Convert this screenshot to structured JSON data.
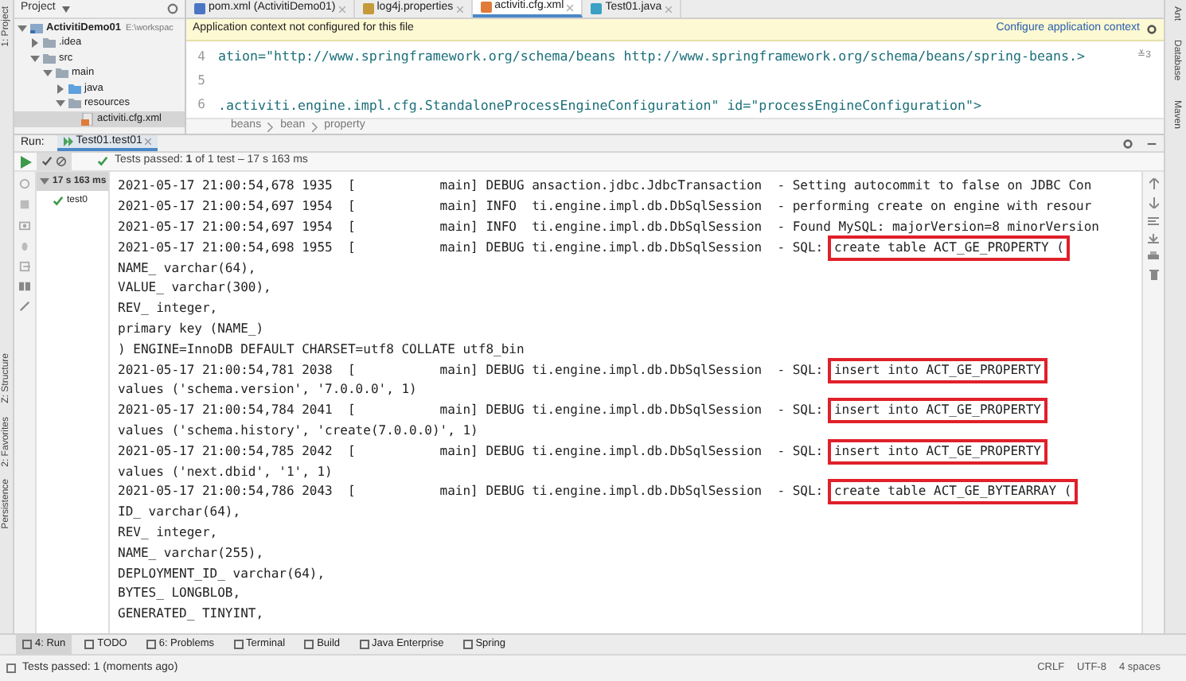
{
  "left_strip": [
    {
      "label": "1: Project"
    },
    {
      "label": "Z: Structure"
    },
    {
      "label": "2: Favorites"
    },
    {
      "label": "Persistence"
    }
  ],
  "project": {
    "title": "Project",
    "tree": [
      {
        "label": "ActivitiDemo01",
        "path": "E:\\workspac",
        "kind": "module",
        "expanded": true,
        "selected": false,
        "children": [
          {
            "label": ".idea",
            "kind": "folder",
            "expanded": false,
            "selected": false
          },
          {
            "label": "src",
            "kind": "folder",
            "expanded": true,
            "selected": false,
            "children": [
              {
                "label": "main",
                "kind": "folder",
                "expanded": true,
                "selected": false,
                "children": [
                  {
                    "label": "java",
                    "kind": "source",
                    "expanded": false,
                    "selected": false
                  },
                  {
                    "label": "resources",
                    "kind": "folder",
                    "expanded": true,
                    "selected": false,
                    "children": [
                      {
                        "label": "activiti.cfg.xml",
                        "kind": "xml",
                        "selected": true
                      }
                    ]
                  }
                ]
              }
            ]
          }
        ]
      }
    ]
  },
  "editor": {
    "tabs": [
      {
        "label": "pom.xml (ActivitiDemo01)",
        "kind": "maven",
        "selected": false
      },
      {
        "label": "log4j.properties",
        "kind": "props",
        "selected": false
      },
      {
        "label": "activiti.cfg.xml",
        "kind": "xml",
        "selected": true
      },
      {
        "label": "Test01.java",
        "kind": "java",
        "selected": false
      }
    ],
    "banner": {
      "message": "Application context not configured for this file",
      "action": "Configure application context"
    },
    "lines": [
      {
        "number": "4",
        "code": "ation=\"http://www.springframework.org/schema/beans http://www.springframework.org/schema/beans/spring-beans.>",
        "badge": "≚3"
      },
      {
        "number": "5"
      },
      {
        "number": "6",
        "code": ".activiti.engine.impl.cfg.StandaloneProcessEngineConfiguration\" id=\"processEngineConfiguration\">"
      }
    ],
    "breadcrumb": [
      "beans",
      "bean",
      "property"
    ]
  },
  "right_strip": [
    {
      "label": "Ant"
    },
    {
      "label": "Database"
    },
    {
      "label": "Maven"
    }
  ],
  "run": {
    "label": "Run:",
    "tab": "Test01.test01",
    "status": "Tests passed: **1** of 1 test – 17 s 163 ms",
    "tree": [
      {
        "label": "17 s 163 ms",
        "selected": true
      },
      {
        "label": "test0",
        "selected": false
      }
    ],
    "console": [
      {
        "kind": "log",
        "text": "2021-05-17 21:00:54,678 1935  [           main] DEBUG ansaction.jdbc.JdbcTransaction  - Setting autocommit to false on JDBC Con"
      },
      {
        "kind": "log",
        "text": "2021-05-17 21:00:54,697 1954  [           main] INFO  ti.engine.impl.db.DbSqlSession  - performing create on engine with resour"
      },
      {
        "kind": "log",
        "text": "2021-05-17 21:00:54,697 1954  [           main] INFO  ti.engine.impl.db.DbSqlSession  - Found MySQL: majorVersion=8 minorVersion"
      },
      {
        "kind": "log",
        "text": "2021-05-17 21:00:54,698 1955  [           main] DEBUG ti.engine.impl.db.DbSqlSession  - SQL: ",
        "sql": "create table ACT_GE_PROPERTY (",
        "highlighted": true
      },
      {
        "kind": "plain",
        "text": "NAME_ varchar(64),"
      },
      {
        "kind": "plain",
        "text": "VALUE_ varchar(300),"
      },
      {
        "kind": "plain",
        "text": "REV_ integer,"
      },
      {
        "kind": "plain",
        "text": "primary key (NAME_)"
      },
      {
        "kind": "plain",
        "text": ") ENGINE=InnoDB DEFAULT CHARSET=utf8 COLLATE utf8_bin"
      },
      {
        "kind": "log",
        "text": "2021-05-17 21:00:54,781 2038  [           main] DEBUG ti.engine.impl.db.DbSqlSession  - SQL: ",
        "sql": "insert into ACT_GE_PROPERTY",
        "highlighted": true
      },
      {
        "kind": "plain",
        "text": "values ('schema.version', '7.0.0.0', 1)"
      },
      {
        "kind": "log",
        "text": "2021-05-17 21:00:54,784 2041  [           main] DEBUG ti.engine.impl.db.DbSqlSession  - SQL: ",
        "sql": "insert into ACT_GE_PROPERTY",
        "highlighted": true
      },
      {
        "kind": "plain",
        "text": "values ('schema.history', 'create(7.0.0.0)', 1)"
      },
      {
        "kind": "log",
        "text": "2021-05-17 21:00:54,785 2042  [           main] DEBUG ti.engine.impl.db.DbSqlSession  - SQL: ",
        "sql": "insert into ACT_GE_PROPERTY",
        "highlighted": true
      },
      {
        "kind": "plain",
        "text": "values ('next.dbid', '1', 1)"
      },
      {
        "kind": "log",
        "text": "2021-05-17 21:00:54,786 2043  [           main] DEBUG ti.engine.impl.db.DbSqlSession  - SQL: ",
        "sql": "create table ACT_GE_BYTEARRAY (",
        "highlighted": true
      },
      {
        "kind": "plain",
        "text": "ID_ varchar(64),"
      },
      {
        "kind": "plain",
        "text": "REV_ integer,"
      },
      {
        "kind": "plain",
        "text": "NAME_ varchar(255),"
      },
      {
        "kind": "plain",
        "text": "DEPLOYMENT_ID_ varchar(64),"
      },
      {
        "kind": "plain",
        "text": "BYTES_ LONGBLOB,"
      },
      {
        "kind": "plain",
        "text": "GENERATED_ TINYINT,"
      }
    ]
  },
  "tool_tabs": [
    {
      "label": "4: Run",
      "selected": true
    },
    {
      "label": "TODO",
      "selected": false
    },
    {
      "label": "6: Problems",
      "selected": false
    },
    {
      "label": "Terminal",
      "selected": false
    },
    {
      "label": "Build",
      "selected": false
    },
    {
      "label": "Java Enterprise",
      "selected": false
    },
    {
      "label": "Spring",
      "selected": false
    }
  ],
  "status_bar": {
    "message": "Tests passed: 1 (moments ago)",
    "items": [
      "CRLF",
      "UTF-8",
      "4 spaces"
    ]
  }
}
